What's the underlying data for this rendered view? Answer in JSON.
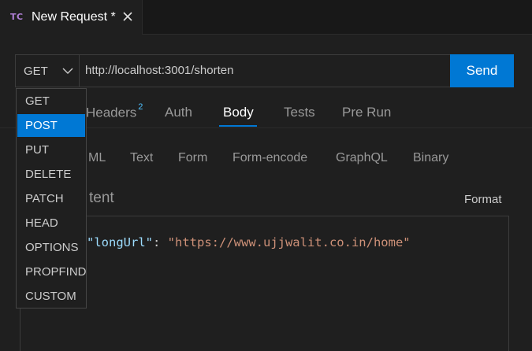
{
  "tab": {
    "icon_text": "TC",
    "title": "New Request *"
  },
  "request": {
    "method": "GET",
    "url": "http://localhost:3001/shorten",
    "send_label": "Send"
  },
  "request_tabs": [
    {
      "label": "Headers",
      "badge": "2"
    },
    {
      "label": "Auth"
    },
    {
      "label": "Body",
      "active": true
    },
    {
      "label": "Tests"
    },
    {
      "label": "Pre Run"
    }
  ],
  "body_tabs": [
    "ML",
    "Text",
    "Form",
    "Form-encode",
    "GraphQL",
    "Binary"
  ],
  "content": {
    "label": "tent",
    "format_label": "Format",
    "code": {
      "key": "\"longUrl\"",
      "colon": ": ",
      "value": "\"https://www.ujjwalit.co.in/home\""
    }
  },
  "method_dropdown": {
    "options": [
      "GET",
      "POST",
      "PUT",
      "DELETE",
      "PATCH",
      "HEAD",
      "OPTIONS",
      "PROPFIND",
      "CUSTOM"
    ],
    "highlighted": "POST"
  },
  "colors": {
    "accent": "#0078d4",
    "badge": "#4fc1ff",
    "json_key": "#9cdcfe",
    "json_string": "#ce9178"
  },
  "icons": {
    "close": "close-icon",
    "chevron": "chevron-down-icon"
  }
}
